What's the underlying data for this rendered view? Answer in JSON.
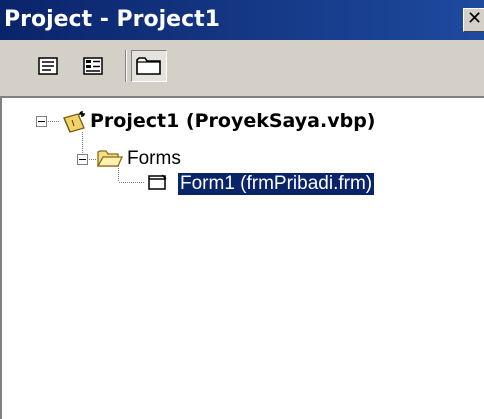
{
  "window": {
    "title": "Project - Project1",
    "close_glyph": "✕"
  },
  "toolbar": {
    "buttons": [
      {
        "icon": "view-code-icon",
        "pressed": false
      },
      {
        "icon": "view-object-icon",
        "pressed": false
      },
      {
        "icon": "toggle-folders-icon",
        "pressed": true
      }
    ]
  },
  "tree": {
    "root_label": "Project1 (ProyekSaya.vbp)",
    "forms_folder_label": "Forms",
    "form_item_label": "Form1 (frmPribadi.frm)"
  },
  "colors": {
    "titlebar": "#0a246a",
    "selection": "#0a246a",
    "chrome": "#d4d0c8"
  }
}
